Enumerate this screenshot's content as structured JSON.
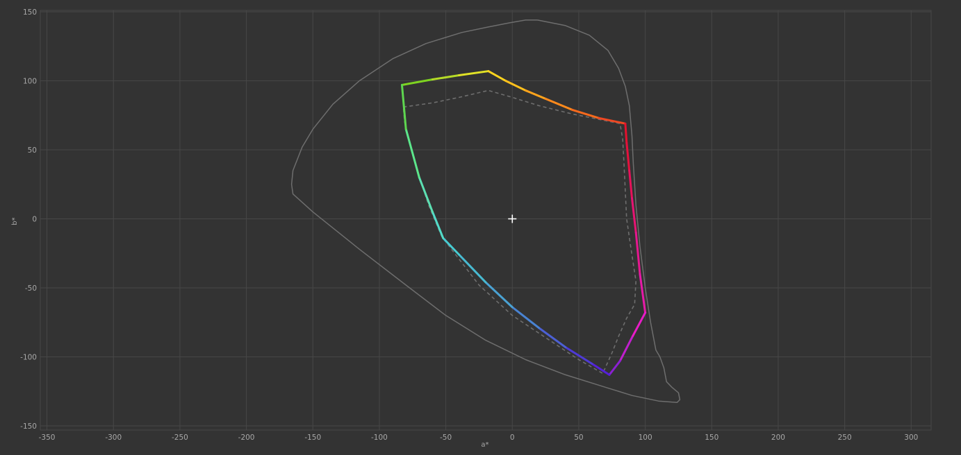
{
  "chart_data": {
    "type": "line",
    "xlabel": "a*",
    "ylabel": "b*",
    "xlim": [
      -355,
      315
    ],
    "ylim": [
      -153,
      151
    ],
    "x_ticks": [
      -350,
      -300,
      -250,
      -200,
      -150,
      -100,
      -50,
      0,
      50,
      100,
      150,
      200,
      250,
      300
    ],
    "y_ticks": [
      150,
      100,
      50,
      0,
      -50,
      -100,
      -150
    ],
    "grid": true,
    "center_marker": {
      "a": 0,
      "b": 0
    },
    "colors": {
      "background": "#333333",
      "grid": "#474747",
      "text": "#a8a8a8",
      "reference": "#6e6e6e",
      "marker": "#ffffff"
    },
    "series": [
      {
        "style": "solid-gray",
        "x": [
          19,
          40,
          58,
          72,
          80,
          85,
          88,
          90,
          91,
          93,
          96,
          100,
          104,
          108,
          111,
          114,
          115,
          116,
          120,
          125,
          126,
          124,
          110,
          90,
          70,
          40,
          10,
          -20,
          -50,
          -80,
          -115,
          -150,
          -165,
          -166,
          -165,
          -158,
          -150,
          -135,
          -115,
          -90,
          -65,
          -38,
          -18,
          -2,
          10,
          19
        ],
        "y": [
          144,
          140,
          133,
          122,
          109,
          96,
          82,
          60,
          40,
          10,
          -20,
          -50,
          -75,
          -95,
          -100,
          -108,
          -113,
          -118,
          -122,
          -126,
          -131,
          -133,
          -132,
          -128,
          -122,
          -113,
          -102,
          -88,
          -70,
          -48,
          -22,
          5,
          18,
          25,
          35,
          52,
          65,
          83,
          100,
          116,
          127,
          135,
          139,
          142,
          144,
          144
        ]
      },
      {
        "style": "dashed-gray",
        "x": [
          -82,
          -60,
          -40,
          -18,
          0,
          20,
          45,
          81,
          83,
          84,
          85,
          86,
          89,
          93,
          92,
          86,
          80,
          75,
          68,
          50,
          25,
          0,
          -25,
          -53,
          -63,
          -73,
          -81,
          -82
        ],
        "y": [
          81,
          84,
          88,
          93,
          88,
          82,
          76,
          69,
          58,
          40,
          20,
          0,
          -20,
          -45,
          -62,
          -72,
          -85,
          -97,
          -112,
          -102,
          -86,
          -70,
          -48,
          -13,
          10,
          40,
          70,
          81
        ]
      },
      {
        "style": "gamut",
        "x": [
          -83,
          -60,
          -40,
          -18,
          -5,
          10,
          25,
          45,
          65,
          85,
          86,
          88,
          90,
          93,
          96,
          100,
          90,
          81,
          73,
          60,
          40,
          20,
          0,
          -20,
          -40,
          -52,
          -60,
          -70,
          -80,
          -83
        ],
        "y": [
          97,
          101,
          104,
          107,
          100,
          93,
          87,
          79,
          73,
          69,
          55,
          35,
          15,
          -10,
          -40,
          -68,
          -86,
          -103,
          -113,
          -105,
          -93,
          -79,
          -64,
          -46,
          -26,
          -14,
          5,
          30,
          65,
          97
        ],
        "colors": [
          "#7ed321",
          "#b5da27",
          "#e1e227",
          "#ffd51e",
          "#ffc01c",
          "#ffa41c",
          "#ff8a1c",
          "#f76a1d",
          "#ef4823",
          "#e4112e",
          "#e5113d",
          "#e7115a",
          "#e61473",
          "#e6178f",
          "#e61aa8",
          "#e81cc7",
          "#c01fcd",
          "#8b20d2",
          "#5520d8",
          "#4e3ad6",
          "#4c60d4",
          "#4983d2",
          "#4aa2d3",
          "#48bad1",
          "#47ccd2",
          "#52dbc8",
          "#5cdfb2",
          "#5ce68b",
          "#5ed64f",
          "#7ed321"
        ]
      }
    ]
  }
}
